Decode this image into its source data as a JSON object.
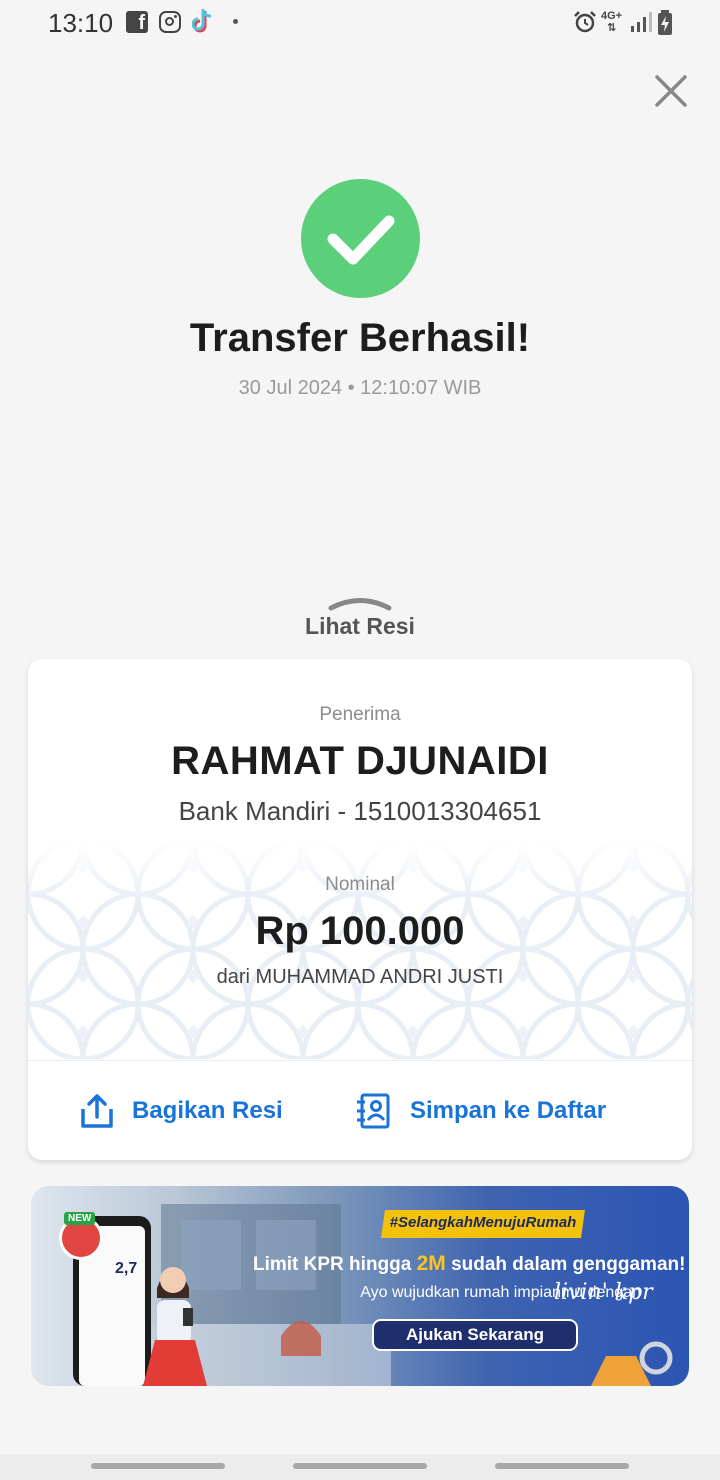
{
  "status_bar": {
    "time": "13:10",
    "network": "4G+",
    "icons": [
      "facebook-icon",
      "instagram-icon",
      "tiktok-icon",
      "notification-dot-icon",
      "alarm-icon",
      "signal-icon",
      "battery-charging-icon"
    ]
  },
  "header": {
    "close_icon": "close-icon"
  },
  "result": {
    "icon": "check-circle-icon",
    "title": "Transfer Berhasil!",
    "timestamp": "30 Jul 2024 • 12:10:07 WIB"
  },
  "receipt_toggle": {
    "label": "Lihat Resi"
  },
  "receipt": {
    "recipient_label": "Penerima",
    "recipient_name": "RAHMAT DJUNAIDI",
    "recipient_bank": "Bank Mandiri - 1510013304651",
    "amount_label": "Nominal",
    "amount": "Rp 100.000",
    "sender": "dari MUHAMMAD ANDRI JUSTI",
    "actions": {
      "share_label": "Bagikan Resi",
      "save_label": "Simpan ke Daftar"
    }
  },
  "promo": {
    "hashtag": "#SelangkahMenujuRumah",
    "headline_before": "Limit KPR hingga ",
    "headline_highlight": "2M",
    "headline_after": " sudah dalam genggaman!",
    "subline": "Ayo wujudkan rumah impianmu dengan",
    "brand": "livin' kpr",
    "cta": "Ajukan Sekarang",
    "badge": "NEW",
    "rate": "2,7",
    "colors": {
      "accent_yellow": "#f4c20d",
      "cta_bg": "#1f2f6e"
    }
  },
  "colors": {
    "success": "#5ccf7b",
    "action_blue": "#1a73d9",
    "background": "#f5f5f5"
  }
}
